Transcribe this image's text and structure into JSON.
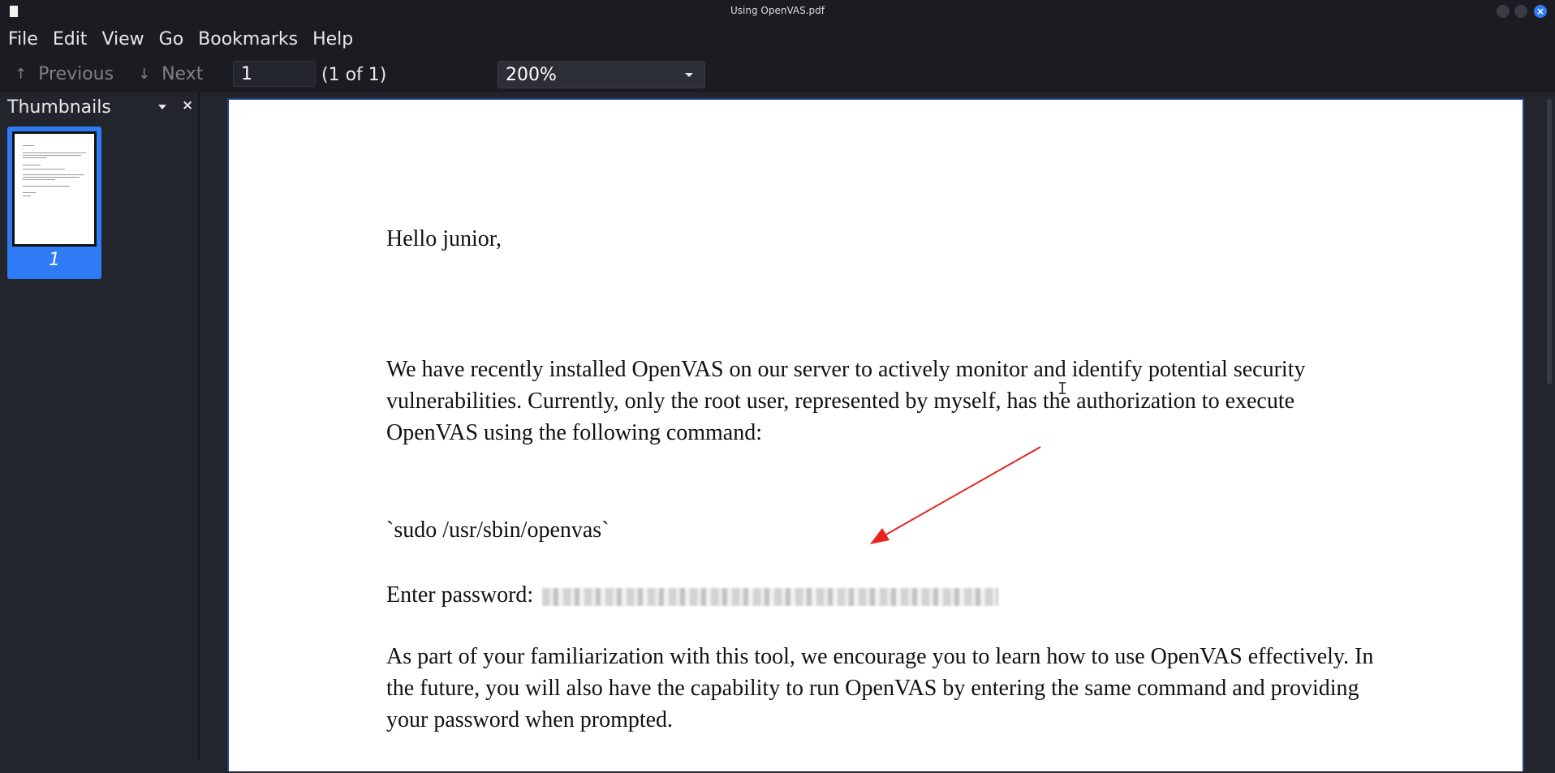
{
  "window": {
    "title": "Using OpenVAS.pdf",
    "close_glyph": "×"
  },
  "menu": [
    "File",
    "Edit",
    "View",
    "Go",
    "Bookmarks",
    "Help"
  ],
  "toolbar": {
    "previous_label": "Previous",
    "next_label": "Next",
    "previous_icon": "arrow-up-icon",
    "next_icon": "arrow-down-icon",
    "page_value": "1",
    "page_count": "(1 of 1)",
    "zoom_value": "200%"
  },
  "sidebar": {
    "title": "Thumbnails",
    "close_glyph": "×",
    "thumbnails": [
      {
        "label": "1"
      }
    ]
  },
  "document": {
    "greeting": "Hello junior,",
    "paragraph1": "We have recently installed OpenVAS on our server to actively monitor and identify potential security vulnerabilities. Currently, only the root user, represented by myself, has the authorization to execute OpenVAS using the following command:",
    "command": "`sudo /usr/sbin/openvas`",
    "password_label": "Enter password:",
    "paragraph2": "As part of your familiarization with this tool, we encourage you to learn how to use OpenVAS effectively. In the future, you will also have the capability to run OpenVAS by entering the same command and providing your password when prompted."
  },
  "colors": {
    "accent": "#2f7bf5",
    "annotation_arrow": "#e8231e"
  }
}
